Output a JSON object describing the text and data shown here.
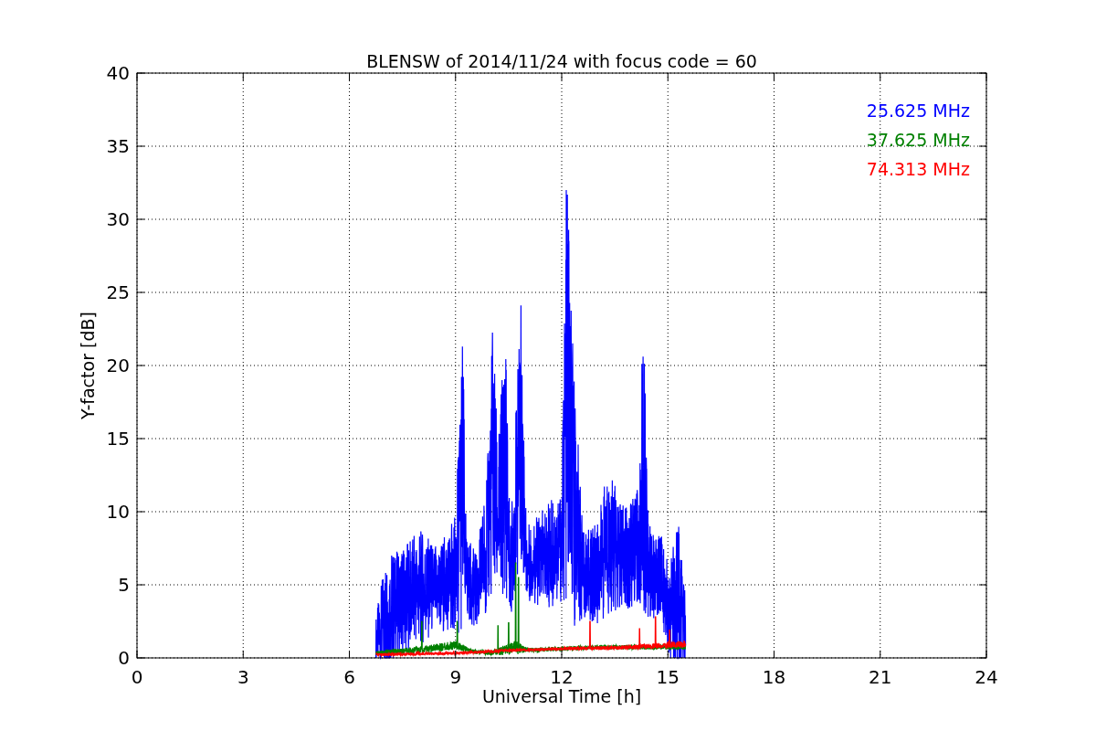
{
  "plot": {
    "title": "BLENSW of 2014/11/24 with focus code = 60",
    "x_axis": {
      "label": "Universal Time [h]",
      "ticks": [
        "0",
        "3",
        "6",
        "9",
        "12",
        "15",
        "18",
        "21",
        "24"
      ]
    },
    "y_axis": {
      "label": "Y-factor [dB]",
      "ticks": [
        "40",
        "35",
        "30",
        "25",
        "20",
        "15",
        "10",
        "5",
        "0"
      ]
    },
    "legend": [
      {
        "label": "25.625 MHz",
        "color": "#0000ff"
      },
      {
        "label": "37.625 MHz",
        "color": "#008000"
      },
      {
        "label": "74.313 MHz",
        "color": "#ff0000"
      }
    ]
  }
}
